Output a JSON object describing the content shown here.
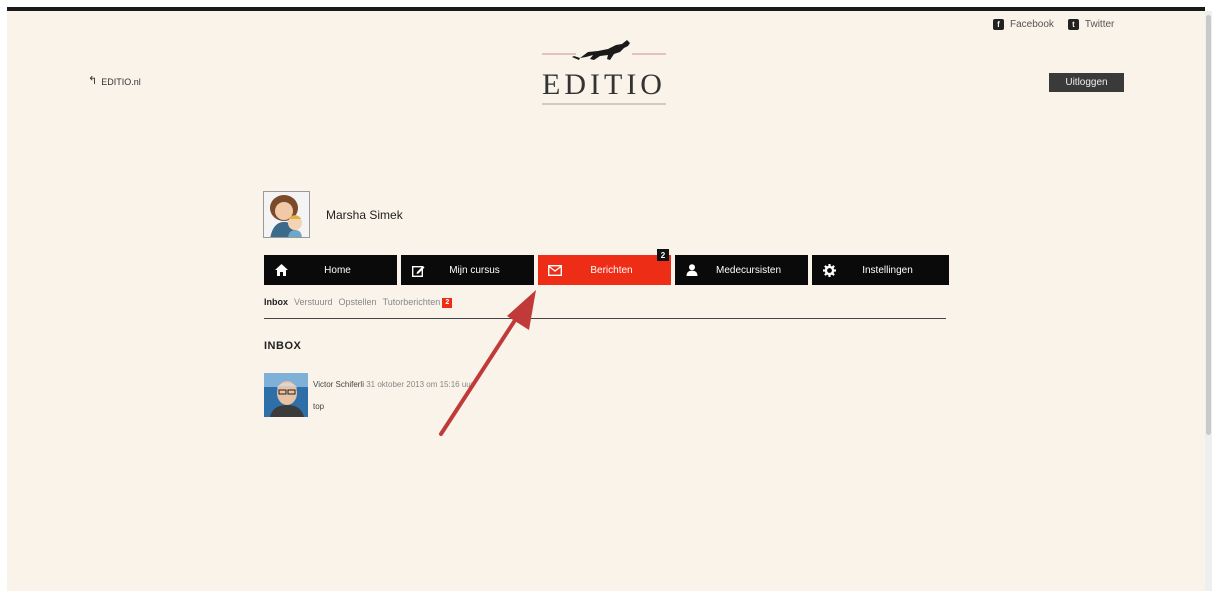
{
  "header": {
    "social": [
      {
        "label": "Facebook",
        "icon": "facebook-icon"
      },
      {
        "label": "Twitter",
        "icon": "twitter-icon"
      }
    ],
    "back_link": "EDITIO.nl",
    "logo_text": "EDITIO",
    "logout_label": "Uitloggen"
  },
  "profile": {
    "name": "Marsha Simek"
  },
  "tabs": [
    {
      "label": "Home",
      "icon": "home-icon",
      "active": false
    },
    {
      "label": "Mijn cursus",
      "icon": "edit-icon",
      "active": false
    },
    {
      "label": "Berichten",
      "icon": "envelope-icon",
      "active": true,
      "badge": "2"
    },
    {
      "label": "Medecursisten",
      "icon": "user-icon",
      "active": false
    },
    {
      "label": "Instellingen",
      "icon": "gear-icon",
      "active": false
    }
  ],
  "subnav": {
    "inbox": "Inbox",
    "sent": "Verstuurd",
    "compose": "Opstellen",
    "tutor": "Tutorberichten",
    "tutor_badge": "2"
  },
  "inbox": {
    "title": "INBOX",
    "messages": [
      {
        "sender": "Victor Schiferli",
        "date": "31 oktober 2013 om 15:16 uur",
        "preview": "top"
      }
    ]
  },
  "colors": {
    "accent": "#ee2d16",
    "background": "#f9f3e9",
    "tab_bg": "#0a0a0a"
  }
}
